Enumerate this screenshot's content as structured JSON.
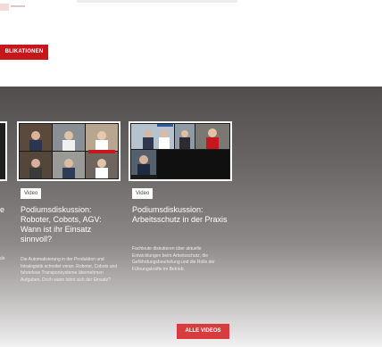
{
  "top": {
    "publications_button": "BLIKATIONEN"
  },
  "videos": {
    "cards": [
      {
        "badge": "Video",
        "title": "Podiumsdiskussion: Roboter, Cobots, AGV: Wann ist ihr Einsatz sinnvoll?",
        "description": "Die Automatisierung in der Produktion und Intralogistik schreitet voran. Roboter, Cobots und fahrerlose Transportsysteme übernehmen Aufgaben. Doch wann lohnt sich der Einsatz?"
      },
      {
        "badge": "Video",
        "title": "Podiumsdiskussion: Arbeitsschutz in der Praxis",
        "description": "Fachleute diskutieren über aktuelle Entwicklungen beim Arbeitsschutz, die Gefährdungsbeurteilung und die Rolle der Führungskräfte im Betrieb."
      }
    ],
    "left_partial_title": "e",
    "left_partial_desc": "de"
  },
  "all_videos_button": "ALLE VIDEOS"
}
